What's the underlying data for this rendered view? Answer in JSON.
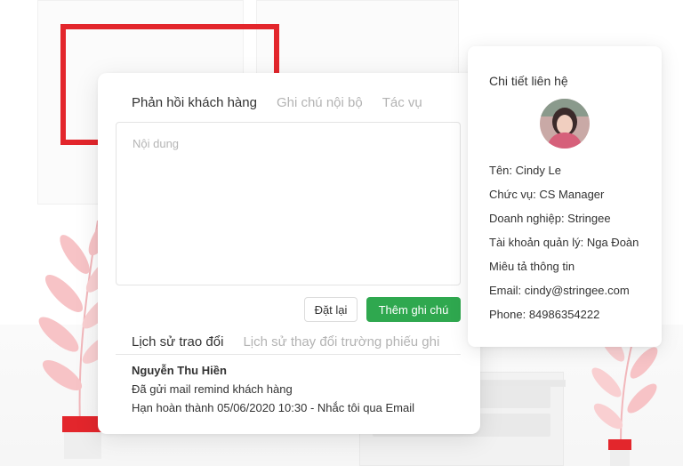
{
  "response_panel": {
    "tabs": [
      {
        "label": "Phản hồi khách hàng"
      },
      {
        "label": "Ghi chú nội bộ"
      },
      {
        "label": "Tác vụ"
      }
    ],
    "content_placeholder": "Nội dung",
    "reset_label": "Đặt lại",
    "add_note_label": "Thêm ghi chú",
    "history_tabs": [
      {
        "label": "Lịch sử trao đổi"
      },
      {
        "label": "Lịch sử thay đổi trường phiếu ghi"
      }
    ],
    "history_entry": {
      "author": "Nguyễn Thu Hiền",
      "message": "Đã gửi mail remind khách hàng",
      "deadline": "Hạn hoàn thành 05/06/2020 10:30 - Nhắc tôi qua Email"
    }
  },
  "contact": {
    "title": "Chi tiết liên hệ",
    "lines": [
      "Tên: Cindy Le",
      "Chức vụ: CS Manager",
      "Doanh nghiệp: Stringee",
      "Tài khoản quản lý: Nga Đoàn",
      "Miêu tả thông tin",
      "Email: cindy@stringee.com",
      "Phone: 84986354222"
    ]
  },
  "colors": {
    "accent_green": "#2fa84f",
    "frame_red": "#e3262c",
    "leaf_pink": "#f7c3c6"
  }
}
